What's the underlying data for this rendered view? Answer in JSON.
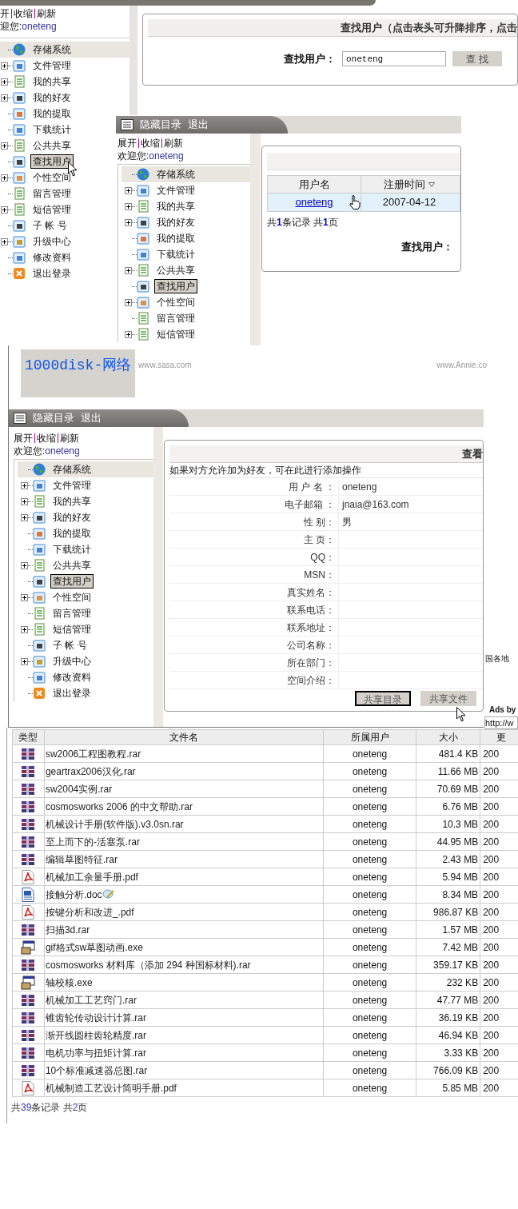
{
  "window_1": {
    "toolbar": [
      "开",
      "收缩",
      "刷新"
    ],
    "welcome": {
      "label": "迎您:",
      "user": "oneteng"
    },
    "tree": [
      {
        "label": "存储系统",
        "kind": "globe",
        "expandable": false,
        "selected": false
      },
      {
        "label": "文件管理",
        "kind": "doc",
        "expandable": true,
        "selected": false
      },
      {
        "label": "我的共享",
        "kind": "share",
        "expandable": true,
        "selected": false
      },
      {
        "label": "我的好友",
        "kind": "friend",
        "expandable": true,
        "selected": false
      },
      {
        "label": "我的提取",
        "kind": "fetch",
        "expandable": false,
        "selected": false
      },
      {
        "label": "下载统计",
        "kind": "stats",
        "expandable": false,
        "selected": false
      },
      {
        "label": "公共共享",
        "kind": "share",
        "expandable": true,
        "selected": false
      },
      {
        "label": "查找用户",
        "kind": "friend",
        "expandable": false,
        "selected": true
      },
      {
        "label": "个性空间",
        "kind": "space",
        "expandable": true,
        "selected": false
      },
      {
        "label": "留言管理",
        "kind": "note",
        "expandable": false,
        "selected": false
      },
      {
        "label": "短信管理",
        "kind": "note",
        "expandable": true,
        "selected": false
      },
      {
        "label": "子 帐 号",
        "kind": "friend",
        "expandable": false,
        "selected": false
      },
      {
        "label": "升级中心",
        "kind": "upgrade",
        "expandable": true,
        "selected": false
      },
      {
        "label": "修改资料",
        "kind": "stats",
        "expandable": false,
        "selected": false
      },
      {
        "label": "退出登录",
        "kind": "exit",
        "expandable": false,
        "selected": false
      }
    ],
    "panel_title": "查找用户（点击表头可升降排序，点击",
    "search": {
      "label": "查找用户：",
      "value": "oneteng",
      "button": "查 找"
    }
  },
  "window_2": {
    "title_bar": [
      "隐藏目录",
      "退出"
    ],
    "toolbar": [
      "展开",
      "收缩",
      "刷新"
    ],
    "welcome": {
      "label": "欢迎您:",
      "user": "oneteng"
    },
    "tree": [
      {
        "label": "存储系统",
        "kind": "globe",
        "expandable": false,
        "selected": false
      },
      {
        "label": "文件管理",
        "kind": "doc",
        "expandable": true,
        "selected": false
      },
      {
        "label": "我的共享",
        "kind": "share",
        "expandable": true,
        "selected": false
      },
      {
        "label": "我的好友",
        "kind": "friend",
        "expandable": true,
        "selected": false
      },
      {
        "label": "我的提取",
        "kind": "fetch",
        "expandable": false,
        "selected": false
      },
      {
        "label": "下载统计",
        "kind": "stats",
        "expandable": false,
        "selected": false
      },
      {
        "label": "公共共享",
        "kind": "share",
        "expandable": true,
        "selected": false
      },
      {
        "label": "查找用户",
        "kind": "friend",
        "expandable": false,
        "selected": true
      },
      {
        "label": "个性空间",
        "kind": "space",
        "expandable": true,
        "selected": false
      },
      {
        "label": "留言管理",
        "kind": "note",
        "expandable": false,
        "selected": false
      },
      {
        "label": "短信管理",
        "kind": "note",
        "expandable": true,
        "selected": false
      }
    ],
    "results": {
      "columns": [
        "用户名",
        "注册时间"
      ],
      "rows": [
        {
          "name": "oneteng",
          "registered": "2007-04-12",
          "selected": true
        }
      ],
      "summary": "共**1**条记录 共**1**页",
      "search_label": "查找用户："
    }
  },
  "banner": {
    "title": "1000disk-网络",
    "ads": [
      "www.sasa.com",
      "www.Annie.co"
    ]
  },
  "window_3": {
    "title_bar": [
      "隐藏目录",
      "退出"
    ],
    "toolbar": [
      "展开",
      "收缩",
      "刷新"
    ],
    "welcome": {
      "label": "欢迎您:",
      "user": "oneteng"
    },
    "tree": [
      {
        "label": "存储系统",
        "kind": "globe",
        "expandable": false,
        "selected": false
      },
      {
        "label": "文件管理",
        "kind": "doc",
        "expandable": true,
        "selected": false
      },
      {
        "label": "我的共享",
        "kind": "share",
        "expandable": true,
        "selected": false
      },
      {
        "label": "我的好友",
        "kind": "friend",
        "expandable": true,
        "selected": false
      },
      {
        "label": "我的提取",
        "kind": "fetch",
        "expandable": false,
        "selected": false
      },
      {
        "label": "下载统计",
        "kind": "stats",
        "expandable": false,
        "selected": false
      },
      {
        "label": "公共共享",
        "kind": "share",
        "expandable": true,
        "selected": false
      },
      {
        "label": "查找用户",
        "kind": "friend",
        "expandable": false,
        "selected": true
      },
      {
        "label": "个性空间",
        "kind": "space",
        "expandable": true,
        "selected": false
      },
      {
        "label": "留言管理",
        "kind": "note",
        "expandable": false,
        "selected": false
      },
      {
        "label": "短信管理",
        "kind": "note",
        "expandable": true,
        "selected": false
      },
      {
        "label": "子 帐 号",
        "kind": "friend",
        "expandable": false,
        "selected": false
      },
      {
        "label": "升级中心",
        "kind": "upgrade",
        "expandable": true,
        "selected": false
      },
      {
        "label": "修改资料",
        "kind": "stats",
        "expandable": false,
        "selected": false
      },
      {
        "label": "退出登录",
        "kind": "exit",
        "expandable": false,
        "selected": false
      }
    ],
    "profile": {
      "heading": "查看",
      "note": "如果对方允许加为好友，可在此进行添加操作",
      "fields": [
        {
          "label": "用 户 名 ：",
          "value": "oneteng"
        },
        {
          "label": "电子邮箱 ：",
          "value": "jnaia@163.com"
        },
        {
          "label": "性 别：",
          "value": "男"
        },
        {
          "label": "主 页："
        },
        {
          "label": "QQ："
        },
        {
          "label": "MSN："
        },
        {
          "label": "真实姓名："
        },
        {
          "label": "联系电话："
        },
        {
          "label": "联系地址："
        },
        {
          "label": "公司名称："
        },
        {
          "label": "所在部门："
        },
        {
          "label": "空间介绍："
        }
      ],
      "buttons": [
        {
          "label": "共享目录",
          "focused": true
        },
        {
          "label": "共享文件",
          "focused": false
        }
      ]
    }
  },
  "fragments": {
    "region": "国各地",
    "ads_label": "Ads by",
    "address": "http://w"
  },
  "file_table": {
    "columns": [
      "类型",
      "文件名",
      "所属用户",
      "大小",
      "更"
    ],
    "rows": [
      {
        "kind": "rar",
        "name": "sw2006工程图教程.rar",
        "edited": false,
        "owner": "oneteng",
        "size": "481.4 KB",
        "updated": "200"
      },
      {
        "kind": "rar",
        "name": "geartrax2006汉化.rar",
        "edited": false,
        "owner": "oneteng",
        "size": "11.66 MB",
        "updated": "200"
      },
      {
        "kind": "rar",
        "name": "sw2004实例.rar",
        "edited": false,
        "owner": "oneteng",
        "size": "70.69 MB",
        "updated": "200"
      },
      {
        "kind": "rar",
        "name": "cosmosworks 2006 的中文帮助.rar",
        "edited": false,
        "owner": "oneteng",
        "size": "6.76 MB",
        "updated": "200"
      },
      {
        "kind": "rar",
        "name": "机械设计手册(软件版).v3.0sn.rar",
        "edited": false,
        "owner": "oneteng",
        "size": "10.3 MB",
        "updated": "200"
      },
      {
        "kind": "rar",
        "name": "至上而下的-活塞泵.rar",
        "edited": false,
        "owner": "oneteng",
        "size": "44.95 MB",
        "updated": "200"
      },
      {
        "kind": "rar",
        "name": "编辑草图特征.rar",
        "edited": false,
        "owner": "oneteng",
        "size": "2.43 MB",
        "updated": "200"
      },
      {
        "kind": "pdf",
        "name": "机械加工余量手册.pdf",
        "edited": false,
        "owner": "oneteng",
        "size": "5.94 MB",
        "updated": "200"
      },
      {
        "kind": "doc",
        "name": "接触分析.doc",
        "edited": true,
        "owner": "oneteng",
        "size": "8.34 MB",
        "updated": "200"
      },
      {
        "kind": "pdf",
        "name": "按键分析和改进_.pdf",
        "edited": false,
        "owner": "oneteng",
        "size": "986.87 KB",
        "updated": "200"
      },
      {
        "kind": "rar",
        "name": "扫描3d.rar",
        "edited": false,
        "owner": "oneteng",
        "size": "1.57 MB",
        "updated": "200"
      },
      {
        "kind": "exe",
        "name": "gif格式sw草图动画.exe",
        "edited": false,
        "owner": "oneteng",
        "size": "7.42 MB",
        "updated": "200"
      },
      {
        "kind": "rar",
        "name": "cosmosworks 材料库（添加 294 种国标材料).rar",
        "edited": false,
        "owner": "oneteng",
        "size": "359.17 KB",
        "updated": "200"
      },
      {
        "kind": "exe",
        "name": "轴校核.exe",
        "edited": false,
        "owner": "oneteng",
        "size": "232 KB",
        "updated": "200"
      },
      {
        "kind": "rar",
        "name": "机械加工工艺窍门.rar",
        "edited": false,
        "owner": "oneteng",
        "size": "47.77 MB",
        "updated": "200"
      },
      {
        "kind": "rar",
        "name": "锥齿轮传动设计计算.rar",
        "edited": false,
        "owner": "oneteng",
        "size": "36.19 KB",
        "updated": "200"
      },
      {
        "kind": "rar",
        "name": "渐开线圆柱齿轮精度.rar",
        "edited": false,
        "owner": "oneteng",
        "size": "46.94 KB",
        "updated": "200"
      },
      {
        "kind": "rar",
        "name": "电机功率与扭矩计算.rar",
        "edited": false,
        "owner": "oneteng",
        "size": "3.33 KB",
        "updated": "200"
      },
      {
        "kind": "rar",
        "name": "10个标准减速器总图.rar",
        "edited": false,
        "owner": "oneteng",
        "size": "766.09 KB",
        "updated": "200"
      },
      {
        "kind": "pdf",
        "name": "机械制造工艺设计简明手册.pdf",
        "edited": false,
        "owner": "oneteng",
        "size": "5.85 MB",
        "updated": "200"
      }
    ],
    "footer": "共**39**条记录 共**2**页"
  }
}
